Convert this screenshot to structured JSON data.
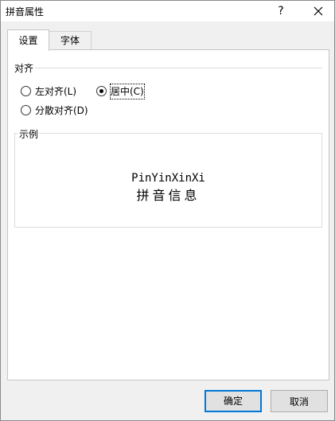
{
  "window": {
    "title": "拼音属性",
    "help_label": "?",
    "close_icon": "close-icon"
  },
  "tabs": [
    {
      "label": "设置",
      "active": true
    },
    {
      "label": "字体",
      "active": false
    }
  ],
  "alignment": {
    "group_label": "对齐",
    "options": [
      {
        "label": "左对齐(L)",
        "selected": false
      },
      {
        "label": "居中(C)",
        "selected": true
      },
      {
        "label": "分散对齐(D)",
        "selected": false
      }
    ]
  },
  "example": {
    "label": "示例",
    "pinyin": "PinYinXinXi",
    "characters": "拼音信息"
  },
  "buttons": {
    "ok_label": "确定",
    "cancel_label": "取消"
  }
}
